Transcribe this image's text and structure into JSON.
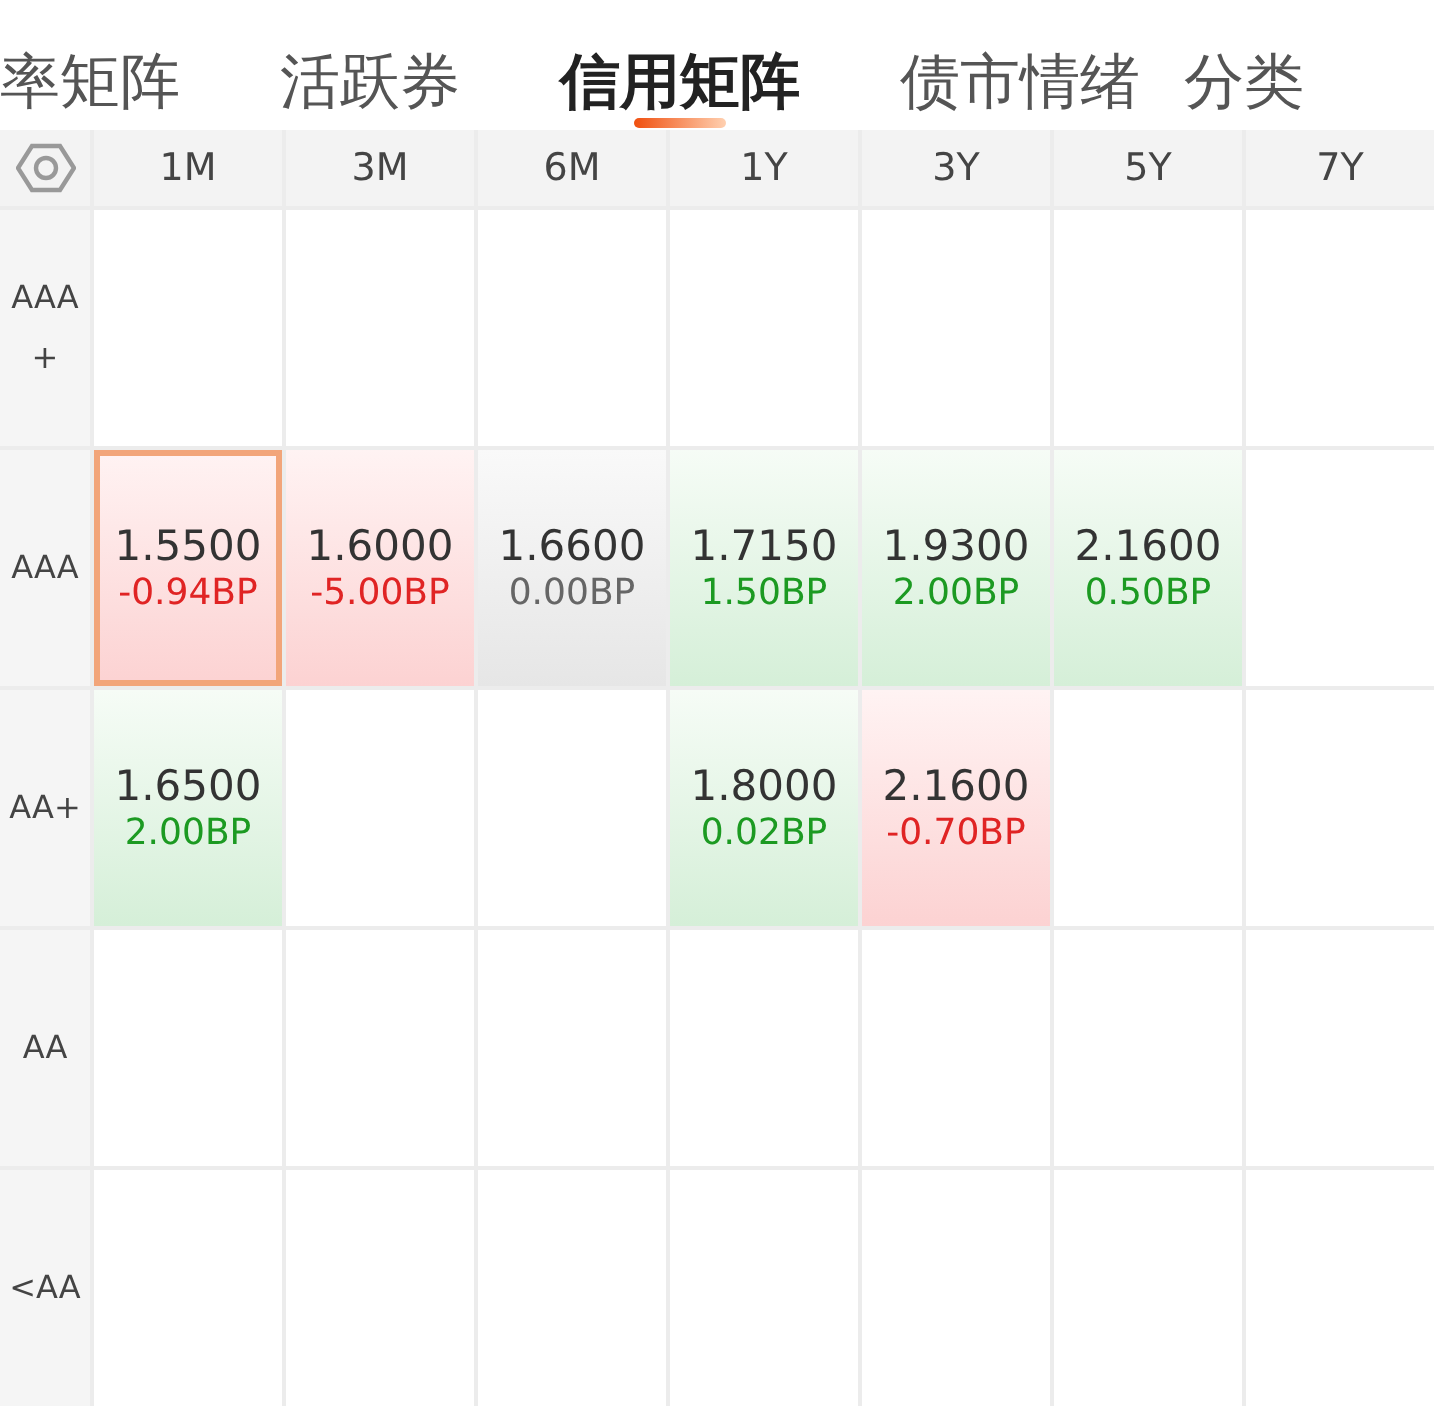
{
  "tabs": [
    {
      "label": "率矩阵",
      "selected": false
    },
    {
      "label": "活跃券",
      "selected": false
    },
    {
      "label": "信用矩阵",
      "selected": true
    },
    {
      "label": "债市情绪",
      "selected": false
    },
    {
      "label": "分类",
      "selected": false
    }
  ],
  "matrix": {
    "columns": [
      "1M",
      "3M",
      "6M",
      "1Y",
      "3Y",
      "5Y",
      "7Y"
    ],
    "rows": [
      {
        "label": "AAA+",
        "cells": [
          {
            "kind": "empty",
            "selected": false
          },
          {
            "kind": "empty",
            "selected": false
          },
          {
            "kind": "empty",
            "selected": false
          },
          {
            "kind": "empty",
            "selected": false
          },
          {
            "kind": "empty",
            "selected": false
          },
          {
            "kind": "empty",
            "selected": false
          },
          {
            "kind": "empty",
            "selected": false
          }
        ]
      },
      {
        "label": "AAA",
        "cells": [
          {
            "kind": "down",
            "value": "1.5500",
            "change": "-0.94BP",
            "selected": true
          },
          {
            "kind": "down",
            "value": "1.6000",
            "change": "-5.00BP",
            "selected": false
          },
          {
            "kind": "flat",
            "value": "1.6600",
            "change": "0.00BP",
            "selected": false
          },
          {
            "kind": "up",
            "value": "1.7150",
            "change": "1.50BP",
            "selected": false
          },
          {
            "kind": "up",
            "value": "1.9300",
            "change": "2.00BP",
            "selected": false
          },
          {
            "kind": "up",
            "value": "2.1600",
            "change": "0.50BP",
            "selected": false
          },
          {
            "kind": "empty",
            "selected": false
          }
        ]
      },
      {
        "label": "AA+",
        "cells": [
          {
            "kind": "up",
            "value": "1.6500",
            "change": "2.00BP",
            "selected": false
          },
          {
            "kind": "empty",
            "selected": false
          },
          {
            "kind": "empty",
            "selected": false
          },
          {
            "kind": "up",
            "value": "1.8000",
            "change": "0.02BP",
            "selected": false
          },
          {
            "kind": "down",
            "value": "2.1600",
            "change": "-0.70BP",
            "selected": false
          },
          {
            "kind": "empty",
            "selected": false
          },
          {
            "kind": "empty",
            "selected": false
          }
        ]
      },
      {
        "label": "AA",
        "cells": [
          {
            "kind": "empty",
            "selected": false
          },
          {
            "kind": "empty",
            "selected": false
          },
          {
            "kind": "empty",
            "selected": false
          },
          {
            "kind": "empty",
            "selected": false
          },
          {
            "kind": "empty",
            "selected": false
          },
          {
            "kind": "empty",
            "selected": false
          },
          {
            "kind": "empty",
            "selected": false
          }
        ]
      },
      {
        "label": "<AA",
        "cells": [
          {
            "kind": "empty",
            "selected": false
          },
          {
            "kind": "empty",
            "selected": false
          },
          {
            "kind": "empty",
            "selected": false
          },
          {
            "kind": "empty",
            "selected": false
          },
          {
            "kind": "empty",
            "selected": false
          },
          {
            "kind": "empty",
            "selected": false
          },
          {
            "kind": "empty",
            "selected": false
          }
        ]
      }
    ]
  }
}
